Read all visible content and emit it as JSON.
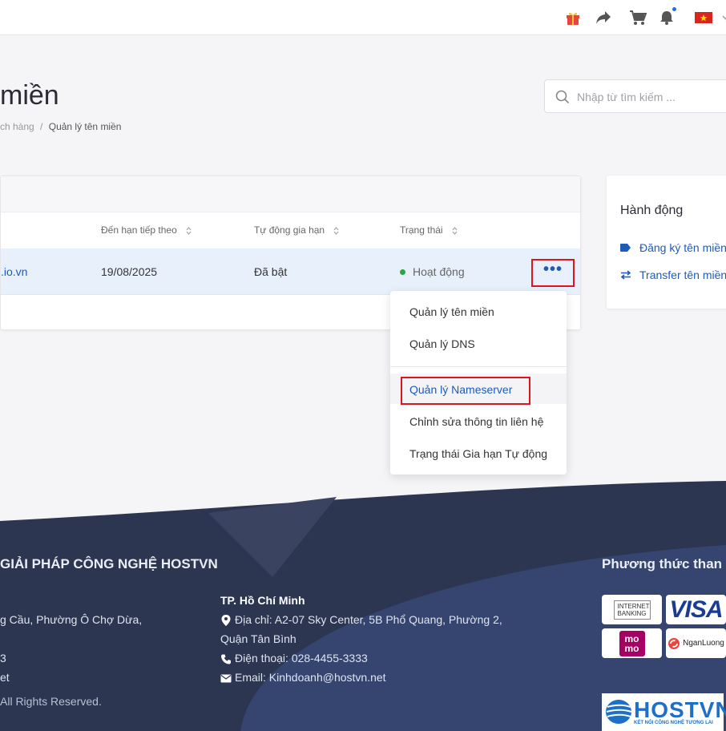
{
  "page": {
    "title": "miền",
    "breadcrumb": {
      "parent": "ch hàng",
      "separator": "/",
      "current": "Quản lý tên miền"
    },
    "search_placeholder": "Nhập từ tìm kiếm ..."
  },
  "topbar": {
    "icons": [
      "gift-icon",
      "share-icon",
      "cart-icon",
      "bell-icon",
      "vietnam-flag-icon",
      "chevron-down-icon"
    ],
    "notification_color": "#1e6fe0"
  },
  "table": {
    "columns": [
      "Đến hạn tiếp theo",
      "Tự động gia hạn",
      "Trạng thái"
    ],
    "rows": [
      {
        "domain": ".io.vn",
        "next_due": "19/08/2025",
        "auto_renew": "Đã bật",
        "status": "Hoạt động",
        "more": "•••"
      }
    ]
  },
  "dropdown": {
    "items": [
      "Quản lý tên miền",
      "Quản lý DNS",
      "Quản lý Nameserver",
      "Chỉnh sửa thông tin liên hệ",
      "Trạng thái Gia hạn Tự động"
    ],
    "highlighted": "Quản lý Nameserver"
  },
  "sidebar": {
    "title": "Hành động",
    "links": [
      "Đăng ký tên miền",
      "Transfer tên miền"
    ]
  },
  "footer": {
    "company": "GIẢI PHÁP CÔNG NGHỆ HOSTVN",
    "left_lines": [
      "g Cầu, Phường Ô Chợ Dừa,",
      "3",
      "et",
      "All Rights Reserved."
    ],
    "hcm": {
      "title": "TP. Hồ Chí Minh",
      "address_1": "Địa chỉ: A2-07 Sky Center, 5B Phổ Quang, Phường 2,",
      "address_2": "Quận Tân Bình",
      "phone": "Điện thoại: 028-4455-3333",
      "email": "Email: Kinhdoanh@hostvn.net"
    },
    "payment_title": "Phương thức than",
    "payments": {
      "internet_banking": "INTERNET BANKING",
      "visa": "VISA",
      "momo": "mo mo",
      "nganluong": "NganLuong"
    },
    "logo": {
      "name": "HOSTVN",
      "tagline": "KẾT NỐI CÔNG NGHỆ TƯƠNG LAI"
    }
  },
  "colors": {
    "accent": "#1e5bb8",
    "highlight_border": "#e0141e",
    "status_active": "#28a745",
    "footer_dark": "#2c3650",
    "footer_mid": "#3a4a6e"
  }
}
